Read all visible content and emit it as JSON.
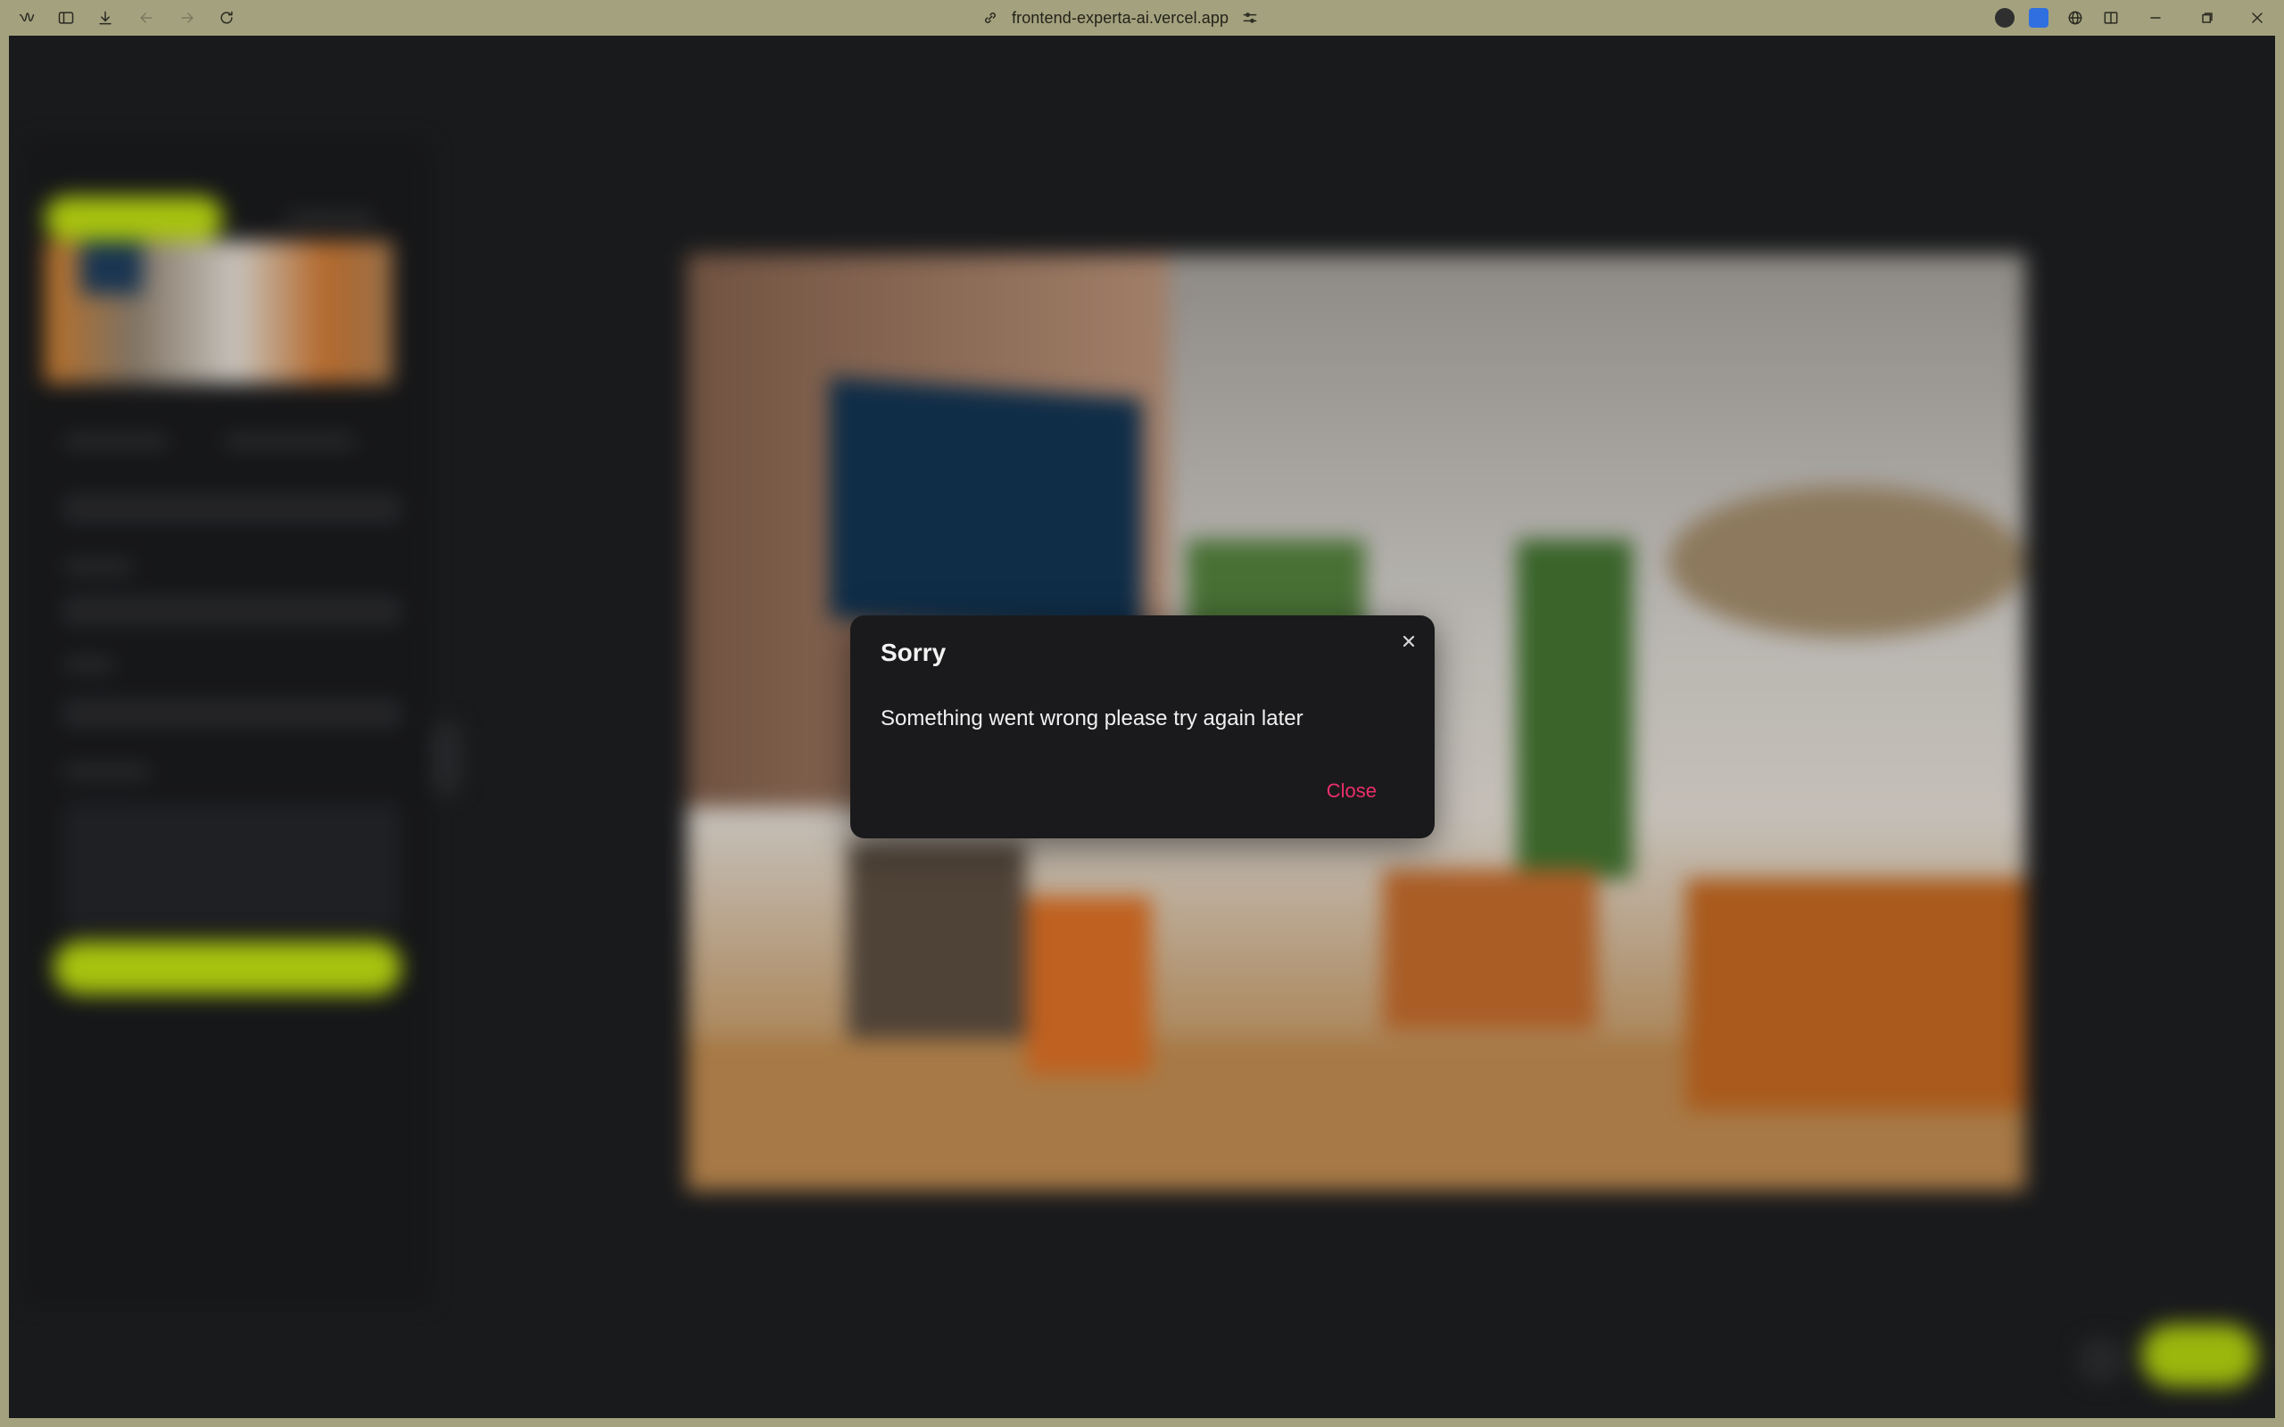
{
  "browser": {
    "url": "frontend-experta-ai.vercel.app"
  },
  "modal": {
    "title": "Sorry",
    "message": "Something went wrong please try again later",
    "close_label": "Close"
  },
  "colors": {
    "accent": "#b6d311",
    "close_link": "#ec2f6b",
    "modal_bg": "#1a1a1c",
    "page_bg": "#1c1d1f"
  }
}
